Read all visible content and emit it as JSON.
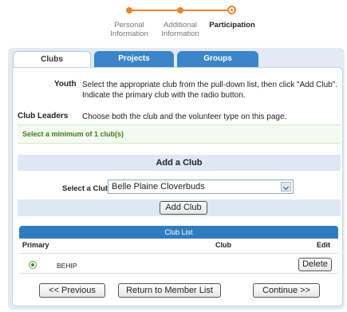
{
  "steps": [
    {
      "label_line1": "Personal",
      "label_line2": "Information",
      "state": "done"
    },
    {
      "label_line1": "Additional",
      "label_line2": "Information",
      "state": "done"
    },
    {
      "label_line1": "Participation",
      "label_line2": "",
      "state": "current"
    }
  ],
  "colors": {
    "accent": "#e8852a",
    "tab_blue": "#3b85c8",
    "header_blue": "#2f7bc0",
    "success_green": "#3b7d1f"
  },
  "tabs": [
    {
      "label": "Clubs",
      "active": true
    },
    {
      "label": "Projects",
      "active": false
    },
    {
      "label": "Groups",
      "active": false
    }
  ],
  "info": {
    "youth_label": "Youth",
    "youth_text_1": "Select the appropriate club from the pull-down list, then click \"Add Club\".",
    "youth_text_2": "Indicate the primary club with the radio button.",
    "leaders_label": "Club Leaders",
    "leaders_text": "Choose both the club and the volunteer type on this page."
  },
  "min_message": "Select a minimum of 1 club(s)",
  "add_club": {
    "title": "Add a Club",
    "select_label": "Select a Club:",
    "selected_value": "Belle Plaine Cloverbuds",
    "add_button": "Add Club"
  },
  "club_list": {
    "title": "Club List",
    "columns": {
      "primary": "Primary",
      "club": "Club",
      "edit": "Edit"
    },
    "rows": [
      {
        "primary": true,
        "club": "BEHIP",
        "action": "Delete"
      }
    ]
  },
  "footer": {
    "previous": "<< Previous",
    "return": "Return to Member List",
    "continue": "Continue >>"
  }
}
